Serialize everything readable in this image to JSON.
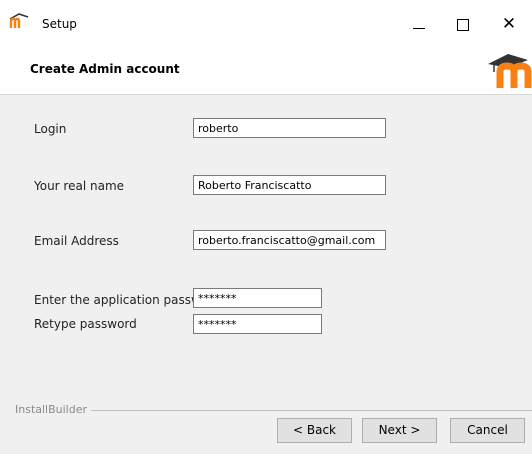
{
  "window": {
    "title": "Setup",
    "controls": {
      "minimize": "—",
      "maximize": "",
      "close": "✕"
    }
  },
  "header": {
    "title": "Create Admin account"
  },
  "form": {
    "login": {
      "label": "Login",
      "value": "roberto"
    },
    "real_name": {
      "label": "Your real name",
      "value": "Roberto Franciscatto"
    },
    "email": {
      "label": "Email Address",
      "value": "roberto.franciscatto@gmail.com"
    },
    "password": {
      "label": "Enter the application password",
      "value": "*******"
    },
    "retype_password": {
      "label": "Retype password",
      "value": "*******"
    }
  },
  "footer": {
    "brand": "InstallBuilder",
    "back_label": "< Back",
    "next_label": "Next >",
    "cancel_label": "Cancel"
  },
  "colors": {
    "logo_orange": "#f98012",
    "logo_dark": "#333333"
  }
}
